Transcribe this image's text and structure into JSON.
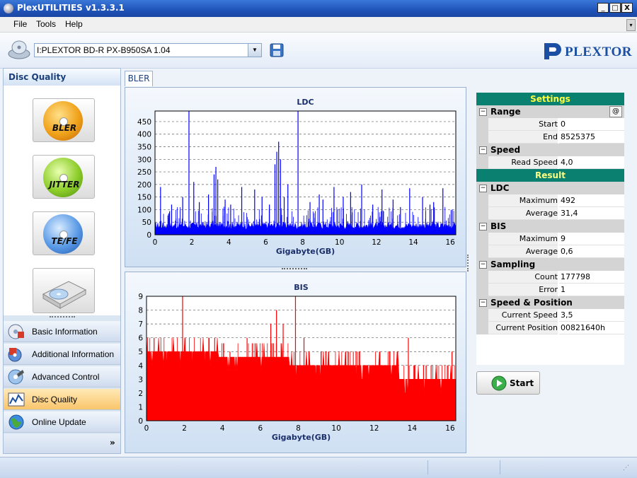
{
  "window": {
    "title": "PlexUTILITIES v1.3.3.1",
    "minimize": "_",
    "maximize": "□",
    "close": "X"
  },
  "menu": [
    "File",
    "Tools",
    "Help"
  ],
  "device": {
    "drive": "I:PLEXTOR BD-R  PX-B950SA  1.04",
    "logo_text": "PLEXTOR"
  },
  "left_panel": {
    "header": "Disc Quality",
    "big_buttons": [
      "BLER",
      "JITTER",
      "TE/FE"
    ],
    "nav": [
      "Basic Information",
      "Additional Information",
      "Advanced Control",
      "Disc Quality",
      "Online Update"
    ],
    "active_nav": "Disc Quality"
  },
  "tab": "BLER",
  "settings": {
    "title": "Settings",
    "range": {
      "label": "Range",
      "start_label": "Start",
      "start": "0",
      "end_label": "End",
      "end": "8525375",
      "at": "@"
    },
    "speed": {
      "label": "Speed",
      "read_label": "Read Speed",
      "read": "4,0"
    }
  },
  "result": {
    "title": "Result",
    "ldc": {
      "label": "LDC",
      "max_label": "Maximum",
      "max": "492",
      "avg_label": "Average",
      "avg": "31,4"
    },
    "bis": {
      "label": "BIS",
      "max_label": "Maximum",
      "max": "9",
      "avg_label": "Average",
      "avg": "0,6"
    },
    "sampling": {
      "label": "Sampling",
      "count_label": "Count",
      "count": "177798",
      "error_label": "Error",
      "error": "1"
    },
    "speedpos": {
      "label": "Speed & Position",
      "cs_label": "Current Speed",
      "cs": "3,5",
      "cp_label": "Current Position",
      "cp": "00821640h"
    }
  },
  "start_label": "Start",
  "chart_data": [
    {
      "type": "bar",
      "title": "LDC",
      "xlabel": "Gigabyte(GB)",
      "ylabel": "",
      "xlim": [
        0,
        16.3
      ],
      "ylim": [
        0,
        492
      ],
      "xticks": [
        0,
        2,
        4,
        6,
        8,
        10,
        12,
        14,
        16
      ],
      "yticks": [
        0,
        50,
        100,
        150,
        200,
        250,
        300,
        350,
        400,
        450
      ],
      "color": "#0000ff",
      "grid": "dashed-horizontal",
      "baseline": 40,
      "spikes": [
        [
          1.84,
          492
        ],
        [
          7.75,
          492
        ],
        [
          6.7,
          370
        ],
        [
          6.6,
          330
        ],
        [
          6.8,
          300
        ],
        [
          6.5,
          280
        ],
        [
          3.3,
          270
        ],
        [
          3.2,
          240
        ],
        [
          3.4,
          220
        ],
        [
          2.1,
          210
        ],
        [
          7.2,
          200
        ],
        [
          11.2,
          200
        ],
        [
          0.3,
          190
        ],
        [
          4.7,
          190
        ],
        [
          5.4,
          180
        ],
        [
          9.7,
          190
        ],
        [
          12.3,
          180
        ],
        [
          13.8,
          185
        ],
        [
          15.6,
          185
        ],
        [
          10.6,
          170
        ],
        [
          8.9,
          160
        ],
        [
          2.9,
          160
        ],
        [
          14.5,
          150
        ],
        [
          1.5,
          150
        ],
        [
          5.8,
          150
        ],
        [
          9.1,
          140
        ],
        [
          12.9,
          140
        ],
        [
          15.1,
          130
        ],
        [
          0.9,
          120
        ],
        [
          4.1,
          120
        ],
        [
          7.0,
          150
        ],
        [
          8.4,
          130
        ],
        [
          11.8,
          120
        ],
        [
          13.3,
          110
        ],
        [
          16.1,
          100
        ],
        [
          10.2,
          150
        ],
        [
          3.8,
          140
        ],
        [
          6.2,
          120
        ],
        [
          14.9,
          120
        ],
        [
          2.4,
          130
        ]
      ]
    },
    {
      "type": "bar",
      "title": "BIS",
      "xlabel": "Gigabyte(GB)",
      "ylabel": "",
      "xlim": [
        0,
        16.3
      ],
      "ylim": [
        0,
        9
      ],
      "xticks": [
        0,
        2,
        4,
        6,
        8,
        10,
        12,
        14,
        16
      ],
      "yticks": [
        0,
        1,
        2,
        3,
        4,
        5,
        6,
        7,
        8,
        9
      ],
      "color": "#ff0000",
      "grid": "dashed-horizontal",
      "levels": [
        [
          0,
          3.8,
          5
        ],
        [
          3.8,
          7.5,
          4.6
        ],
        [
          7.5,
          13.3,
          4
        ],
        [
          13.3,
          16.3,
          3
        ]
      ],
      "spikes": [
        [
          1.9,
          9
        ],
        [
          7.85,
          9
        ],
        [
          6.85,
          8
        ],
        [
          6.55,
          7
        ],
        [
          7.2,
          7
        ],
        [
          5.3,
          6
        ],
        [
          0.4,
          6
        ],
        [
          3.3,
          6
        ],
        [
          8.3,
          6
        ],
        [
          13.8,
          6
        ],
        [
          11.2,
          5
        ],
        [
          9.6,
          5
        ],
        [
          10.5,
          5
        ],
        [
          12.3,
          5
        ],
        [
          16.1,
          5
        ],
        [
          2.6,
          5
        ],
        [
          4.4,
          5
        ],
        [
          15.0,
          4
        ],
        [
          14.6,
          4
        ],
        [
          12.8,
          5
        ]
      ]
    }
  ]
}
